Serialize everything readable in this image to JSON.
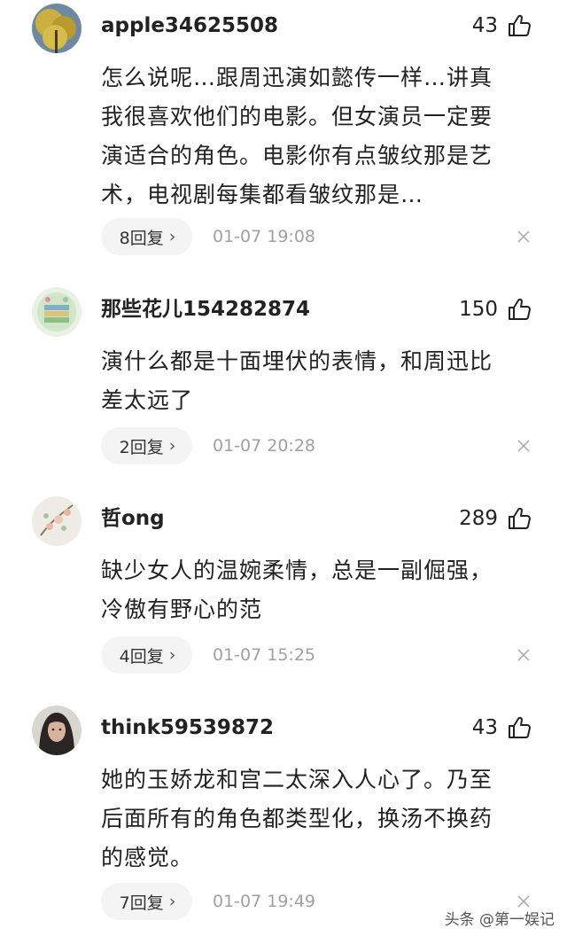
{
  "comments": [
    {
      "username": "apple34625508",
      "likes": "43",
      "text": "怎么说呢…跟周迅演如懿传一样…讲真\n我很喜欢他们的电影。但女演员一定要\n演适合的角色。电影你有点皱纹那是艺\n术，电视剧每集都看皱纹那是…",
      "replies": "8回复",
      "time": "01-07 19:08"
    },
    {
      "username": "那些花儿154282874",
      "likes": "150",
      "text": "演什么都是十面埋伏的表情，和周迅比\n差太远了",
      "replies": "2回复",
      "time": "01-07 20:28"
    },
    {
      "username": "哲ong",
      "likes": "289",
      "text": "缺少女人的温婉柔情，总是一副倔强，\n冷傲有野心的范",
      "replies": "4回复",
      "time": "01-07 15:25"
    },
    {
      "username": "think59539872",
      "likes": "43",
      "text": "她的玉娇龙和宫二太深入人心了。乃至\n后面所有的角色都类型化，换汤不换药\n的感觉。",
      "replies": "7回复",
      "time": "01-07 19:49"
    }
  ],
  "watermark": "头条 @第一娱记",
  "icons": {
    "like": "thumbs-up-icon",
    "close": "close-icon",
    "chevron": "chevron-right-icon"
  }
}
